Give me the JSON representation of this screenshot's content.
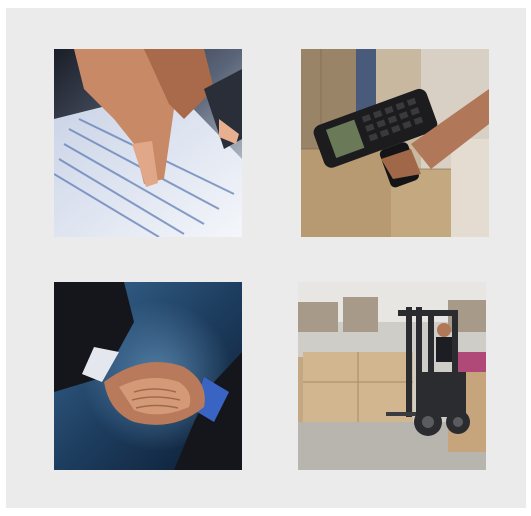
{
  "tiles": [
    {
      "name": "document-review-photo",
      "subject": "hands-over-spreadsheet"
    },
    {
      "name": "barcode-scanner-photo",
      "subject": "handheld-scanner-boxes"
    },
    {
      "name": "handshake-photo",
      "subject": "business-handshake"
    },
    {
      "name": "forklift-warehouse-photo",
      "subject": "forklift-carrying-boxes"
    }
  ],
  "colors": {
    "panel_background": "#ebebeb",
    "page_background": "#ffffff"
  }
}
